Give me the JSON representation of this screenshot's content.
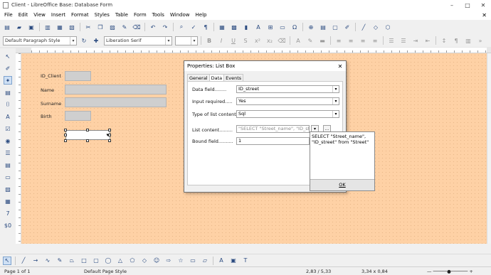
{
  "window": {
    "title": "Client - LibreOffice Base: Database Form",
    "controls": [
      "–",
      "□",
      "✕"
    ]
  },
  "menu": [
    "File",
    "Edit",
    "View",
    "Insert",
    "Format",
    "Styles",
    "Table",
    "Form",
    "Tools",
    "Window",
    "Help"
  ],
  "menu_close": "✕",
  "toolbar2": {
    "paragraph_style": "Default Paragraph Style",
    "font_name": "Liberation Serif",
    "font_size": ""
  },
  "form": {
    "labels": [
      "ID_Client",
      "Name",
      "Surname",
      "Birth"
    ]
  },
  "dialog": {
    "title": "Properties: List Box",
    "close": "✕",
    "tabs": [
      "General",
      "Data",
      "Events"
    ],
    "rows": [
      {
        "label": "Data field",
        "value": "ID_street"
      },
      {
        "label": "Input required",
        "value": "Yes"
      },
      {
        "label": "Type of list contents",
        "value": "Sql"
      },
      {
        "label": "List content",
        "value": "\"SELECT \"Street_name\", \"ID_street\" fro"
      },
      {
        "label": "Bound field",
        "value": "1"
      }
    ],
    "dots": "...",
    "popup_text": "SELECT \"Street_name\",\n\"ID_street\" from \"Street\"",
    "ok": "OK"
  },
  "statusbar": {
    "page": "Page 1 of 1",
    "page_style": "Default Page Style",
    "position": "2,83 / 5,33",
    "size": "3,34 x 0,84"
  },
  "colors": {
    "canvas": "#fed1a5",
    "accent": "#2b4b80"
  }
}
